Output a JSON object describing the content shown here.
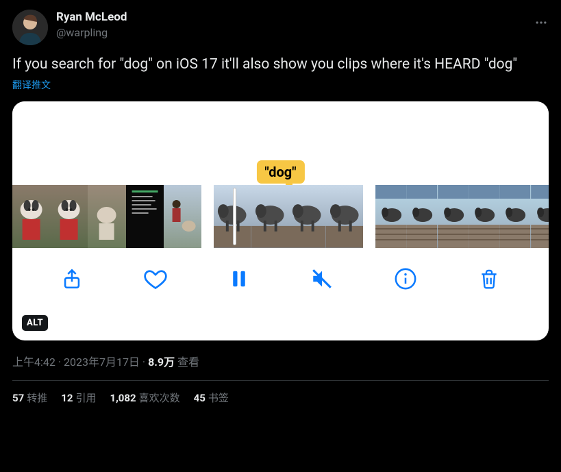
{
  "author": {
    "display_name": "Ryan McLeod",
    "handle": "@warpling"
  },
  "tweet_text": "If you search for \"dog\" on iOS 17 it'll also show you clips where it's HEARD \"dog\"",
  "translate_label": "翻译推文",
  "media": {
    "search_tag": "\"dog\"",
    "alt_badge": "ALT",
    "toolbar_icons": [
      "share",
      "like",
      "pause",
      "mute",
      "info",
      "trash"
    ]
  },
  "meta": {
    "time": "上午4:42",
    "date": "2023年7月17日",
    "views_count": "8.9万",
    "views_label": "查看",
    "sep": " · "
  },
  "stats": {
    "retweets": {
      "count": "57",
      "label": "转推"
    },
    "quotes": {
      "count": "12",
      "label": "引用"
    },
    "likes": {
      "count": "1,082",
      "label": "喜欢次数"
    },
    "bookmarks": {
      "count": "45",
      "label": "书签"
    }
  },
  "colors": {
    "accent": "#1d9bf0",
    "ios_blue": "#0a7aff",
    "tag_bg": "#f7c744"
  }
}
